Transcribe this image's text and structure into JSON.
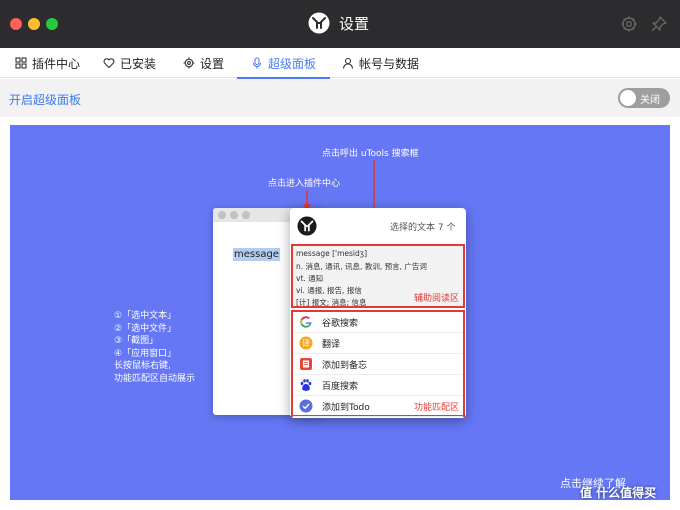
{
  "window": {
    "title": "设置"
  },
  "tabs": [
    {
      "label": "插件中心",
      "icon": "grid-icon"
    },
    {
      "label": "已安装",
      "icon": "heart-icon"
    },
    {
      "label": "设置",
      "icon": "gear-icon"
    },
    {
      "label": "超级面板",
      "icon": "mic-icon",
      "active": true
    },
    {
      "label": "帐号与数据",
      "icon": "user-icon"
    }
  ],
  "toolbar": {
    "enable_label": "开启超级面板",
    "toggle_label": "关闭",
    "toggle_on": false
  },
  "demo": {
    "annotation_search": "点击呼出 uTools 搜索框",
    "annotation_plugin": "点击进入插件中心",
    "sample_word": "message",
    "panel_hint": "选择的文本 7 个",
    "read_lines": [
      "message ['mesidʒ]",
      "n. 消息, 通讯, 讯息, 教训, 预言, 广告词",
      "vt. 通知",
      "vi. 通报, 报告, 报信",
      "[计] 报文; 消息; 信息"
    ],
    "read_area_label": "辅助阅读区",
    "match_items": [
      {
        "label": "谷歌搜索",
        "icon": "google-icon"
      },
      {
        "label": "翻译",
        "icon": "translate-icon"
      },
      {
        "label": "添加到备忘",
        "icon": "memo-icon"
      },
      {
        "label": "百度搜索",
        "icon": "baidu-icon"
      },
      {
        "label": "添加到Todo",
        "icon": "todo-icon"
      }
    ],
    "match_area_label": "功能匹配区",
    "steps": [
      "①「选中文本」",
      "②「选中文件」",
      "③「截图」",
      "④「应用窗口」",
      "长按鼠标右键,",
      "功能匹配区自动展示"
    ],
    "bottom_right": "点击继续了解"
  },
  "watermark": "值 什么值得买",
  "colors": {
    "accent": "#4a7cf6",
    "demo_bg": "#6577f5",
    "highlight_red": "#e53935"
  }
}
